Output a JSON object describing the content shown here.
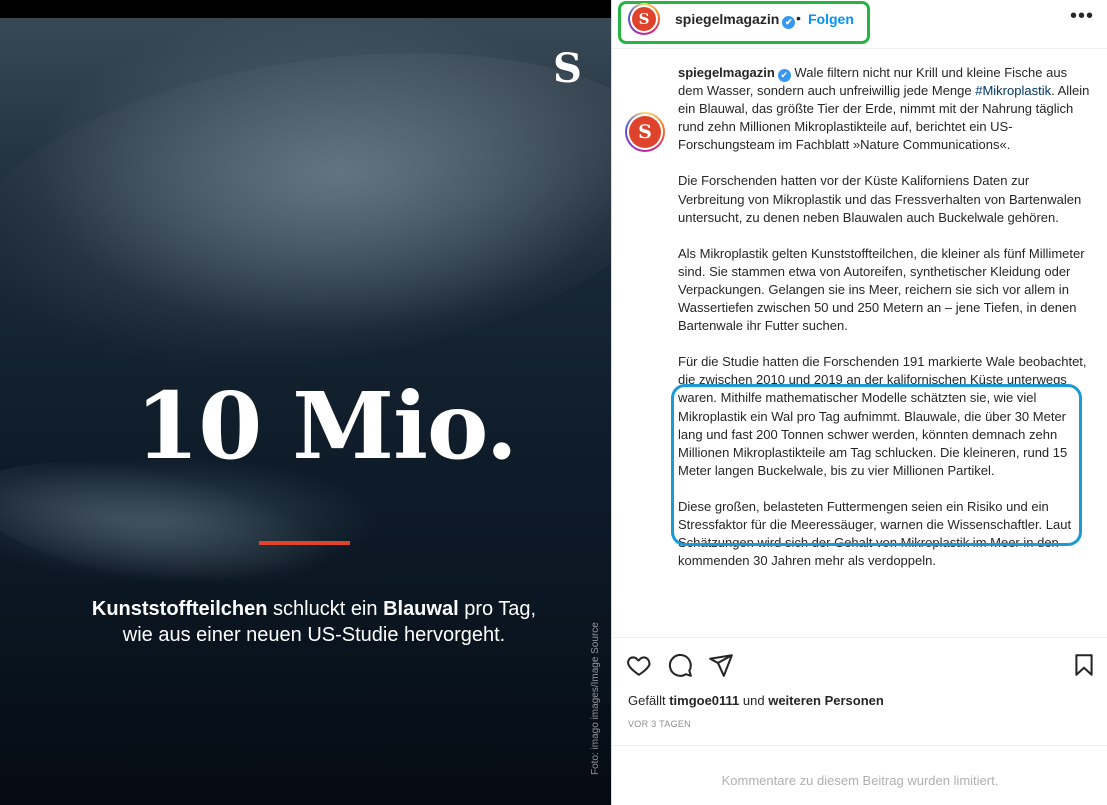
{
  "image": {
    "logo_letter": "S",
    "big_stat": "10 Mio.",
    "caption_parts": [
      {
        "text": "Kunststoffteilchen",
        "bold": true
      },
      {
        "text": " schluckt ein ",
        "bold": false
      },
      {
        "text": "Blauwal",
        "bold": true
      },
      {
        "text": " pro Tag,",
        "bold": false
      }
    ],
    "caption_line2": "wie aus einer neuen US-Studie hervorgeht.",
    "photo_credit": "Foto: imago images/Image Source",
    "accent_color": "#e0432b"
  },
  "header": {
    "avatar_letter": "S",
    "username": "spiegelmagazin",
    "verified_mark": "✔",
    "separator": "•",
    "follow_label": "Folgen",
    "more_label": "•••"
  },
  "caption": {
    "avatar_letter": "S",
    "username": "spiegelmagazin",
    "verified_mark": "✔",
    "p1_before_hashtag": " Wale filtern nicht nur Krill und kleine Fische aus dem Wasser, sondern auch unfreiwillig jede Menge ",
    "hashtag": "#Mikroplastik",
    "p1_after_hashtag": ". Allein ein Blauwal, das größte Tier der Erde, nimmt mit der Nahrung täglich rund zehn Millionen Mikroplastikteile auf, berichtet ein US-Forschungsteam im Fachblatt »Nature Communications«.",
    "p2": "Die Forschenden hatten vor der Küste Kaliforniens Daten zur Verbreitung von Mikroplastik und das Fressverhalten von Bartenwalen untersucht, zu denen neben Blauwalen auch Buckelwale gehören.",
    "p3": "Als Mikroplastik gelten Kunststoffteilchen, die kleiner als fünf Millimeter sind. Sie stammen etwa von Autoreifen, synthetischer Kleidung oder Verpackungen. Gelangen sie ins Meer, reichern sie sich vor allem in Wassertiefen zwischen 50 und 250 Metern an – jene Tiefen, in denen Bartenwale ihr Futter suchen.",
    "p4": "Für die Studie hatten die Forschenden 191 markierte Wale beobachtet, die zwischen 2010 und 2019 an der kalifornischen Küste unterwegs waren. Mithilfe mathematischer Modelle schätzten sie, wie viel Mikroplastik ein Wal pro Tag aufnimmt. Blauwale, die über 30 Meter lang und fast 200 Tonnen schwer werden, könnten demnach zehn Millionen Mikroplastikteile am Tag schlucken. Die kleineren, rund 15 Meter langen Buckelwale, bis zu vier Millionen Partikel.",
    "p5": "Diese großen, belasteten Futtermengen seien ein Risiko und ein Stressfaktor für die Meeressäuger, warnen die Wissenschaftler. Laut Schätzungen wird sich der Gehalt von Mikroplastik im Meer in den kommenden 30 Jahren mehr als verdoppeln."
  },
  "engagement": {
    "liked_prefix": "Gefällt ",
    "liked_user": "timgoe0111",
    "liked_middle": " und ",
    "liked_suffix": "weiteren Personen",
    "timestamp": "VOR 3 TAGEN",
    "comments_notice": "Kommentare zu diesem Beitrag wurden limitiert."
  },
  "colors": {
    "follow": "#0095f6",
    "header_highlight": "#28b445",
    "paragraph_highlight": "#1a9ad6",
    "brand": "#e0432b"
  }
}
